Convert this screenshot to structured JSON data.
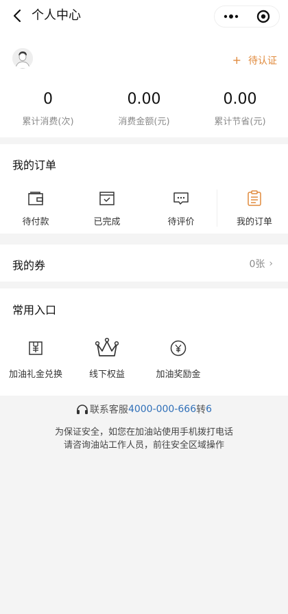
{
  "header": {
    "title": "个人中心"
  },
  "profile": {
    "verify_label": "待认证",
    "stats": [
      {
        "value": "0",
        "label": "累计消费(次)"
      },
      {
        "value": "0.00",
        "label": "消费金额(元)"
      },
      {
        "value": "0.00",
        "label": "累计节省(元)"
      }
    ]
  },
  "orders": {
    "title": "我的订单",
    "items": [
      {
        "label": "待付款",
        "icon": "wallet-icon"
      },
      {
        "label": "已完成",
        "icon": "completed-icon"
      },
      {
        "label": "待评价",
        "icon": "comment-icon"
      },
      {
        "label": "我的订单",
        "icon": "order-list-icon"
      }
    ]
  },
  "coupons": {
    "title": "我的券",
    "count": "0张"
  },
  "entries": {
    "title": "常用入口",
    "items": [
      {
        "label": "加油礼金兑换",
        "icon": "gift-voucher-icon"
      },
      {
        "label": "线下权益",
        "icon": "crown-icon"
      },
      {
        "label": "加油奖励金",
        "icon": "yen-coin-icon"
      }
    ]
  },
  "footer": {
    "service_prefix": "联系客服",
    "service_phone": "4000-000-666",
    "service_mid": "转",
    "service_ext": "6",
    "notice_line1": "为保证安全，如您在加油站使用手机拨打电话",
    "notice_line2": "请咨询油站工作人员，前往安全区域操作"
  },
  "colors": {
    "accent_orange": "#e08a3c",
    "link_blue": "#2f6fb8"
  }
}
